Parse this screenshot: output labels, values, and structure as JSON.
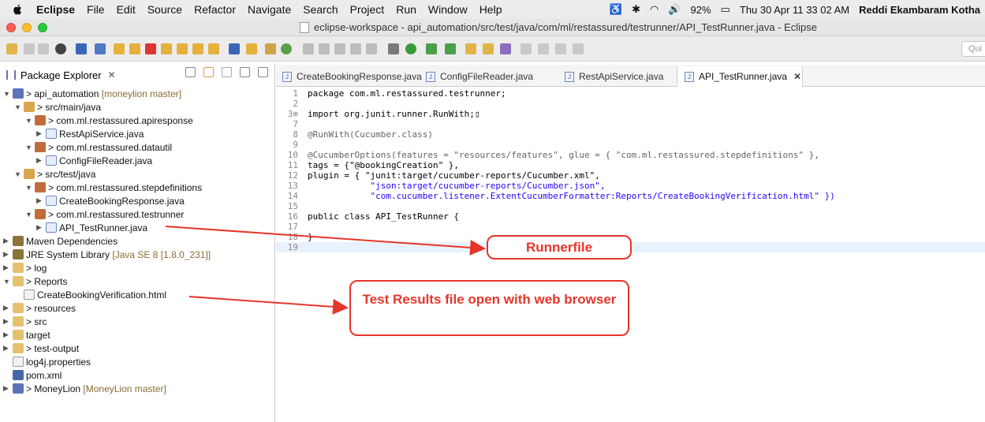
{
  "menubar": {
    "app_name": "Eclipse",
    "items": [
      "File",
      "Edit",
      "Source",
      "Refactor",
      "Navigate",
      "Search",
      "Project",
      "Run",
      "Window",
      "Help"
    ],
    "status": {
      "battery": "92%",
      "datetime": "Thu 30 Apr  11 33 02 AM",
      "user": "Reddi Ekambaram Kotha"
    }
  },
  "window": {
    "title": "eclipse-workspace - api_automation/src/test/java/com/ml/restassured/testrunner/API_TestRunner.java - Eclipse"
  },
  "toolbar": {
    "quick_access_placeholder": "Qui"
  },
  "package_explorer": {
    "tab_label": "Package Explorer",
    "tree": [
      {
        "label": "> api_automation",
        "branch": "[moneylion master]",
        "icon": "project-icon",
        "expand": "▼"
      },
      {
        "label": "> src/main/java",
        "icon": "source-folder-icon",
        "expand": "▼"
      },
      {
        "label": "> com.ml.restassured.apiresponse",
        "icon": "package-icon",
        "expand": "▼"
      },
      {
        "label": "RestApiService.java",
        "icon": "java-file-icon",
        "expand": "▶"
      },
      {
        "label": "> com.ml.restassured.datautil",
        "icon": "package-icon",
        "expand": "▼"
      },
      {
        "label": "ConfigFileReader.java",
        "icon": "java-file-icon",
        "expand": "▶"
      },
      {
        "label": "> src/test/java",
        "icon": "source-folder-icon",
        "expand": "▼"
      },
      {
        "label": "> com.ml.restassured.stepdefinitions",
        "icon": "package-icon",
        "expand": "▼"
      },
      {
        "label": "CreateBookingResponse.java",
        "icon": "java-file-icon",
        "expand": "▶"
      },
      {
        "label": "> com.ml.restassured.testrunner",
        "icon": "package-icon",
        "expand": "▼"
      },
      {
        "label": "API_TestRunner.java",
        "icon": "java-file-icon",
        "expand": "▶"
      },
      {
        "label": "Maven Dependencies",
        "icon": "library-icon",
        "expand": "▶"
      },
      {
        "label": "JRE System Library",
        "branch": "[Java SE 8 [1.8.0_231]]",
        "icon": "library-icon",
        "expand": "▶"
      },
      {
        "label": "> log",
        "icon": "folder-icon",
        "expand": "▶"
      },
      {
        "label": "> Reports",
        "icon": "folder-icon",
        "expand": "▼"
      },
      {
        "label": "CreateBookingVerification.html",
        "icon": "html-file-icon",
        "expand": ""
      },
      {
        "label": "> resources",
        "icon": "folder-icon",
        "expand": "▶"
      },
      {
        "label": "> src",
        "icon": "folder-icon",
        "expand": "▶"
      },
      {
        "label": "target",
        "icon": "folder-icon",
        "expand": "▶"
      },
      {
        "label": "> test-output",
        "icon": "folder-icon",
        "expand": "▶"
      },
      {
        "label": "log4j.properties",
        "icon": "properties-file-icon",
        "expand": ""
      },
      {
        "label": "pom.xml",
        "icon": "xml-file-icon",
        "expand": ""
      },
      {
        "label": "> MoneyLion",
        "branch": "[MoneyLion master]",
        "icon": "project-icon",
        "expand": "▶"
      }
    ]
  },
  "editor": {
    "tabs": [
      {
        "label": "CreateBookingResponse.java",
        "active": false
      },
      {
        "label": "ConfigFileReader.java",
        "active": false
      },
      {
        "label": "RestApiService.java",
        "active": false
      },
      {
        "label": "API_TestRunner.java",
        "active": true
      }
    ],
    "lines": [
      {
        "n": "1",
        "code": "package com.ml.restassured.testrunner;"
      },
      {
        "n": "2",
        "code": ""
      },
      {
        "n": "3⊕",
        "code": "import org.junit.runner.RunWith;▯"
      },
      {
        "n": "7",
        "code": ""
      },
      {
        "n": "8",
        "code": "@RunWith(Cucumber.class)"
      },
      {
        "n": "9",
        "code": ""
      },
      {
        "n": "10",
        "code": "@CucumberOptions(features = \"resources/features\", glue = { \"com.ml.restassured.stepdefinitions\" },"
      },
      {
        "n": "11",
        "code": "tags = {\"@bookingCreation\" },"
      },
      {
        "n": "12",
        "code": "plugin = { \"junit:target/cucumber-reports/Cucumber.xml\","
      },
      {
        "n": "13",
        "code": "            \"json:target/cucumber-reports/Cucumber.json\","
      },
      {
        "n": "14",
        "code": "            \"com.cucumber.listener.ExtentCucumberFormatter:Reports/CreateBookingVerification.html\" })"
      },
      {
        "n": "15",
        "code": ""
      },
      {
        "n": "16",
        "code": "public class API_TestRunner {"
      },
      {
        "n": "17",
        "code": ""
      },
      {
        "n": "18",
        "code": "}"
      },
      {
        "n": "19",
        "code": ""
      }
    ]
  },
  "annotations": {
    "runner": "Runnerfile",
    "results": "Test Results file open with web browser",
    "color": "#e6352a"
  }
}
